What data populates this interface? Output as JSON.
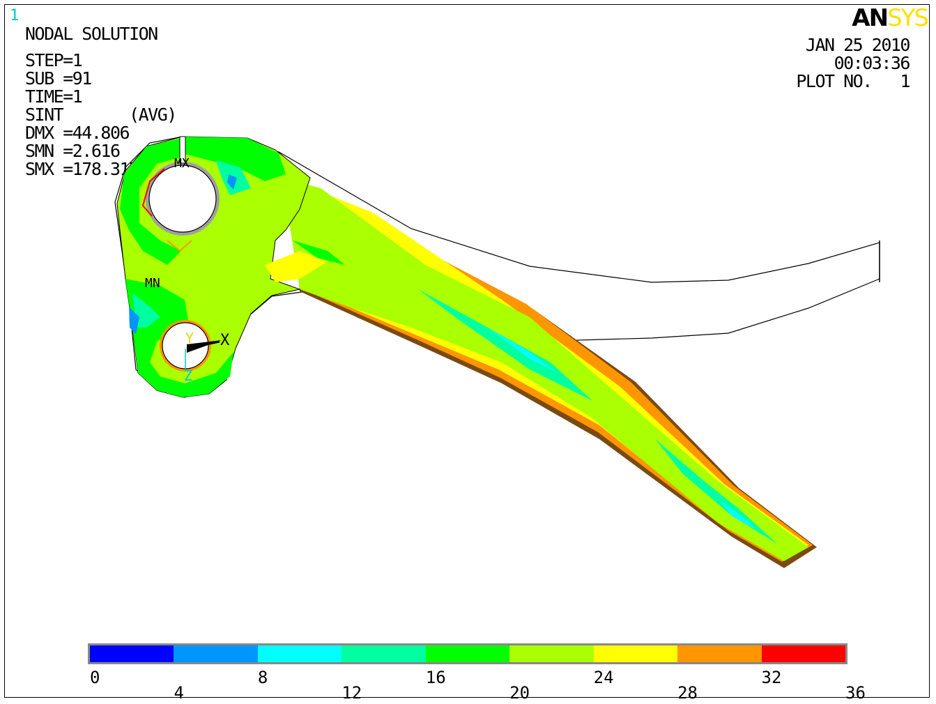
{
  "window_number": "1",
  "logo": {
    "part1": "AN",
    "part2": "SYS"
  },
  "info": {
    "title": "NODAL SOLUTION",
    "step": "STEP=1",
    "sub": "SUB =91",
    "time": "TIME=1",
    "result": "SINT       (AVG)",
    "dmx": "DMX =44.806",
    "smn": "SMN =2.616",
    "smx": "SMX =178.317"
  },
  "datestamp": {
    "date": "JAN 25 2010",
    "time": "00:03:36",
    "plot": "PLOT NO.   1"
  },
  "markers": {
    "mx": "MX",
    "mn": "MN"
  },
  "triad": {
    "y": "Y",
    "x": "X",
    "z": "Z"
  },
  "legend": {
    "colors": [
      "#0000ff",
      "#0096ff",
      "#00ffff",
      "#00ffa0",
      "#00ff00",
      "#aaff00",
      "#ffff00",
      "#ff9600",
      "#ff0000"
    ],
    "labels_top": [
      "0",
      "8",
      "16",
      "24",
      "32"
    ],
    "labels_bottom": [
      "4",
      "12",
      "20",
      "28",
      "36"
    ]
  },
  "palette": {
    "outline": "#000000",
    "gray": "#a0a0a0",
    "brown": "#8b4513"
  }
}
